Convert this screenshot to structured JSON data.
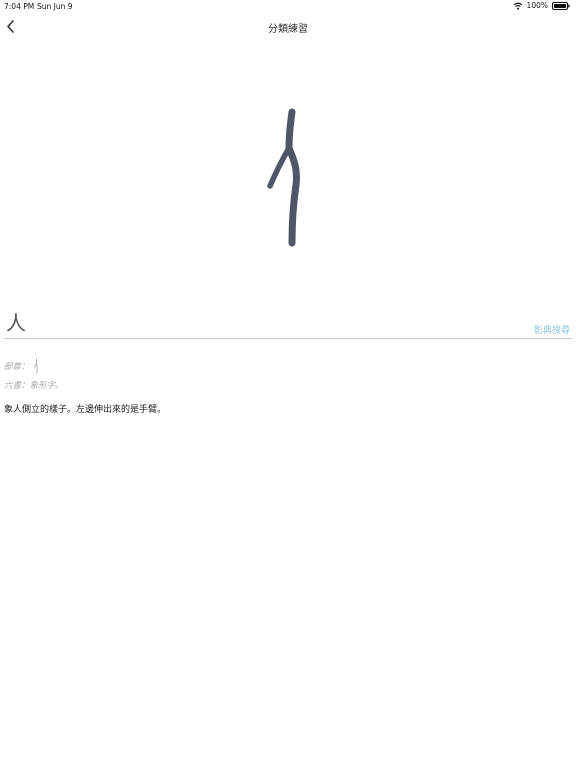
{
  "status_bar": {
    "time": "7:04 PM",
    "date": "Sun Jun 9",
    "battery": "100%",
    "wifi_icon": "wifi-icon",
    "battery_icon": "battery-full-icon"
  },
  "nav": {
    "title": "分類練習",
    "back_icon": "chevron-left-icon"
  },
  "glyph": {
    "icon": "ancient-ren-character",
    "color": "#4f5667"
  },
  "entry": {
    "character": "人",
    "dictionary_link": "影典搜尋",
    "radical_label": "部首：",
    "six_writings_label": "六書：",
    "six_writings_value": "象形字。",
    "description": "象人側立的樣子。左邊伸出來的是手臂。"
  },
  "colors": {
    "link": "#8ec5dd",
    "muted": "#a8a8a8",
    "divider": "#c9c9c9"
  }
}
